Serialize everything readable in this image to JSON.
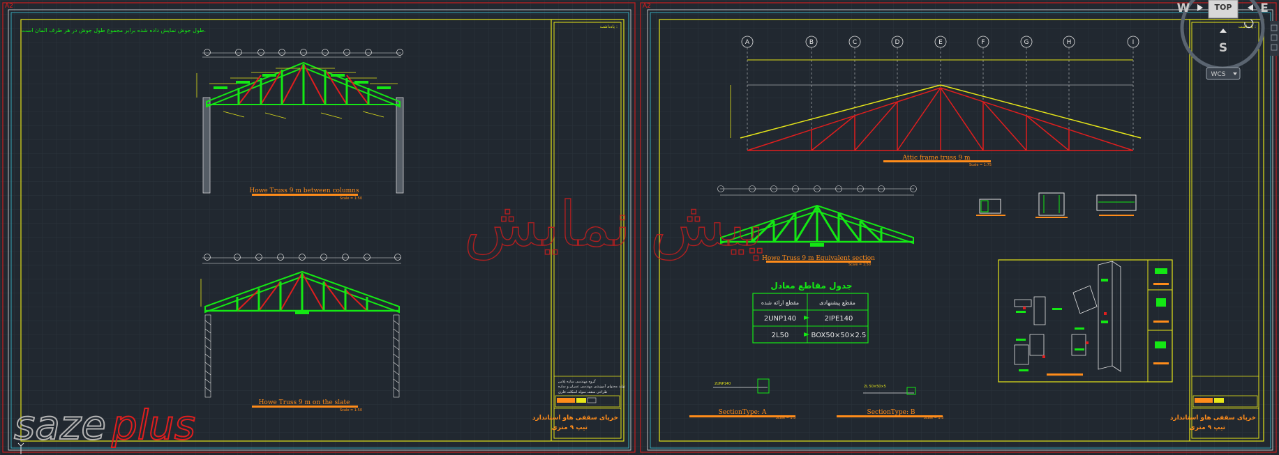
{
  "sheet_tags": {
    "left": "A2",
    "right": "A2"
  },
  "left_sheet": {
    "note": "طول جوش نمایش داده شده برابر مجموع طول جوش در هر طرف المان است.",
    "truss_top": {
      "title": "Howe Truss 9 m between columns",
      "scale": "Scale = 1:50"
    },
    "truss_bottom": {
      "title": "Howe Truss 9 m on the slate",
      "scale": "Scale = 1:50"
    },
    "title_block": {
      "heading": "یادداشت :",
      "company_lines": [
        "گروه مهندسی سازه پلاس",
        "تولید محتوای آموزشی مهندسی عمران و سازه"
      ],
      "project_line": "طراحی سقف سوله اسکلت فلزی",
      "main_title": "خرپای سقفی هاو استاندارد",
      "sub_title": "تیپ ۹ متری"
    }
  },
  "right_sheet": {
    "grid_labels": [
      "A",
      "B",
      "C",
      "D",
      "E",
      "F",
      "G",
      "H",
      "I"
    ],
    "frame_title": "Attic frame truss 9 m",
    "frame_scale": "Scale = 1:75",
    "equiv_title": "Howe Truss 9 m Equivalent section",
    "equiv_scale": "Scale = 1:50",
    "section_titles": [
      "SectionType: A",
      "SectionType: B"
    ],
    "section_scales": [
      "Scale = 1:5",
      "Scale = 1:5"
    ],
    "section_captions": [
      "2UNP140",
      "2L 50×50×5"
    ],
    "table": {
      "title": "جدول مقاطع معادل",
      "headers": [
        "مقطع ارائه شده",
        "مقطع پیشنهادی"
      ],
      "rows": [
        [
          "2UNP140",
          "2IPE140"
        ],
        [
          "2L50",
          "BOX50×50×2.5"
        ]
      ]
    },
    "title_block": {
      "heading": "یادداشت :",
      "main_title": "خرپای سقفی هاو استاندارد",
      "sub_title": "تیپ ۹ متری"
    }
  },
  "watermark": "پیش نمایش",
  "logo": {
    "part1": "saze",
    "part2": "plus"
  },
  "viewcube": {
    "top": "TOP",
    "north": "W",
    "east": "E",
    "south": "S",
    "wcs": "WCS"
  },
  "colors": {
    "bg": "#212830",
    "green": "#14e814",
    "yellow": "#e6e619",
    "red": "#e01e1e",
    "orange": "#ff8c1a",
    "cyan": "#3cc8dc"
  }
}
